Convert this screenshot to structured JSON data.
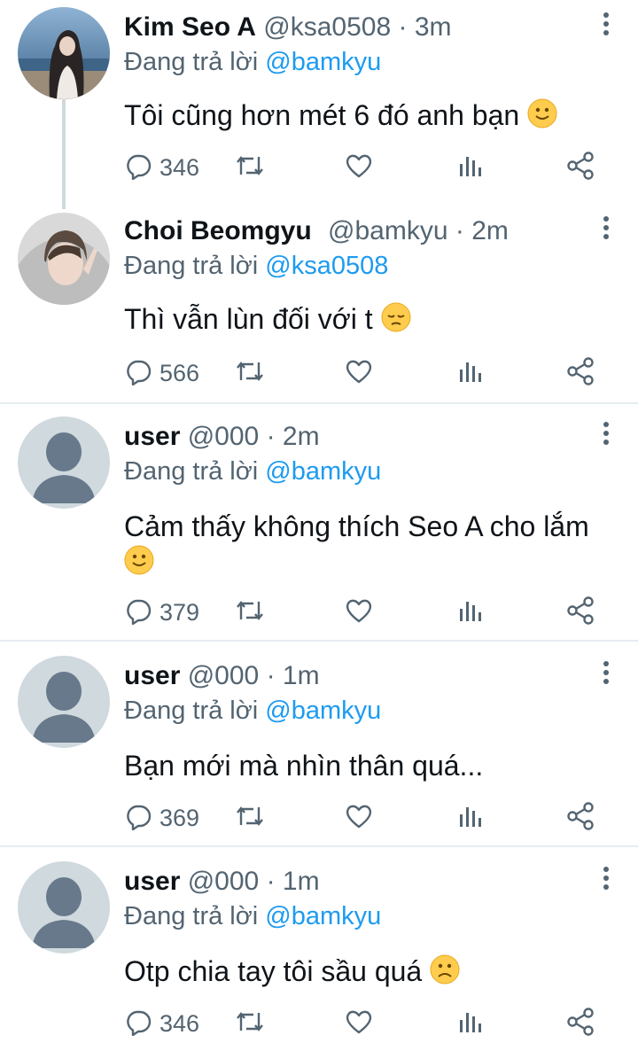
{
  "reply_prefix": "Đang trả lời",
  "tweets": [
    {
      "name": "Kim Seo A",
      "handle": "@ksa0508",
      "separator": "·",
      "time": "3m",
      "reply_to": "@bamkyu",
      "text": "Tôi cũng hơn mét 6 đó anh bạn",
      "emoji": "slightly-smiling-face",
      "replies": "346",
      "avatar": "photo-woman-seaside"
    },
    {
      "name": "Choi Beomgyu",
      "handle": "@bamkyu",
      "separator": "·",
      "time": "2m",
      "reply_to": "@ksa0508",
      "text": "Thì vẫn lùn đối với t",
      "emoji": "pensive-face",
      "replies": "566",
      "avatar": "photo-man-hoodie"
    },
    {
      "name": "user",
      "handle": "@000",
      "separator": "·",
      "time": "2m",
      "reply_to": "@bamkyu",
      "text": "Cảm thấy không thích Seo A cho lắm",
      "emoji": "slightly-smiling-face",
      "replies": "379",
      "avatar": "default-avatar"
    },
    {
      "name": "user",
      "handle": "@000",
      "separator": "·",
      "time": "1m",
      "reply_to": "@bamkyu",
      "text": "Bạn mới mà nhìn thân quá...",
      "emoji": "",
      "replies": "369",
      "avatar": "default-avatar"
    },
    {
      "name": "user",
      "handle": "@000",
      "separator": "·",
      "time": "1m",
      "reply_to": "@bamkyu",
      "text": "Otp chia tay tôi sầu quá",
      "emoji": "frowning-face",
      "replies": "346",
      "avatar": "default-avatar"
    }
  ],
  "colors": {
    "link": "#1d9bf0",
    "muted": "#536471",
    "text": "#0f1419",
    "divider": "#e6ecf0",
    "default_avatar_bg": "#cfd9de",
    "default_avatar_fg": "#67798a"
  }
}
